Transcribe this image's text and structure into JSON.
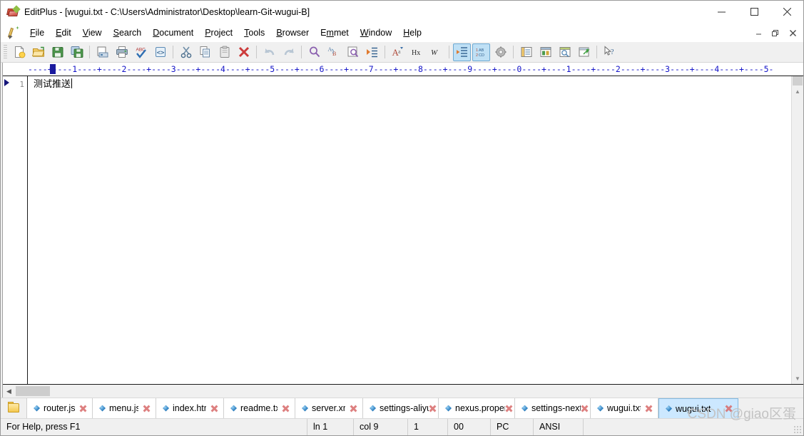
{
  "window": {
    "title": "EditPlus - [wugui.txt - C:\\Users\\Administrator\\Desktop\\learn-Git-wugui-B]",
    "app_icon": "editplus-icon",
    "minimize": "—",
    "maximize": "□",
    "close": "✕",
    "mdi_minimize": "–",
    "mdi_restore": "❐",
    "mdi_close": "✕"
  },
  "menu": [
    {
      "label": "File",
      "accel": "F"
    },
    {
      "label": "Edit",
      "accel": "E"
    },
    {
      "label": "View",
      "accel": "V"
    },
    {
      "label": "Search",
      "accel": "S"
    },
    {
      "label": "Document",
      "accel": "D"
    },
    {
      "label": "Project",
      "accel": "P"
    },
    {
      "label": "Tools",
      "accel": "T"
    },
    {
      "label": "Browser",
      "accel": "B"
    },
    {
      "label": "Emmet",
      "accel": "m"
    },
    {
      "label": "Window",
      "accel": "W"
    },
    {
      "label": "Help",
      "accel": "H"
    }
  ],
  "toolbar": [
    {
      "name": "new-file-icon",
      "sep_after": false,
      "active": false
    },
    {
      "name": "open-file-icon",
      "sep_after": false,
      "active": false
    },
    {
      "name": "save-icon",
      "sep_after": false,
      "active": false
    },
    {
      "name": "save-all-icon",
      "sep_after": true,
      "active": false
    },
    {
      "name": "print-preview-icon",
      "sep_after": false,
      "active": false
    },
    {
      "name": "print-icon",
      "sep_after": false,
      "active": false
    },
    {
      "name": "spell-check-icon",
      "sep_after": false,
      "active": false
    },
    {
      "name": "browser-preview-icon",
      "sep_after": true,
      "active": false
    },
    {
      "name": "cut-icon",
      "sep_after": false,
      "active": false
    },
    {
      "name": "copy-icon",
      "sep_after": false,
      "active": false
    },
    {
      "name": "paste-icon",
      "sep_after": false,
      "active": false
    },
    {
      "name": "delete-icon",
      "sep_after": true,
      "active": false
    },
    {
      "name": "undo-icon",
      "sep_after": false,
      "active": false
    },
    {
      "name": "redo-icon",
      "sep_after": true,
      "active": false
    },
    {
      "name": "find-icon",
      "sep_after": false,
      "active": false
    },
    {
      "name": "replace-icon",
      "sep_after": false,
      "active": false
    },
    {
      "name": "find-in-files-icon",
      "sep_after": false,
      "active": false
    },
    {
      "name": "goto-line-icon",
      "sep_after": true,
      "active": false
    },
    {
      "name": "change-case-icon",
      "sep_after": false,
      "active": false
    },
    {
      "name": "hex-view-icon",
      "sep_after": false,
      "active": false
    },
    {
      "name": "word-wrap-icon",
      "sep_after": true,
      "active": false
    },
    {
      "name": "indent-guide-icon",
      "sep_after": false,
      "active": true
    },
    {
      "name": "line-numbers-icon",
      "sep_after": false,
      "active": true
    },
    {
      "name": "preferences-icon",
      "sep_after": true,
      "active": false
    },
    {
      "name": "directory-window-icon",
      "sep_after": false,
      "active": false
    },
    {
      "name": "output-window-icon",
      "sep_after": false,
      "active": false
    },
    {
      "name": "clip-library-icon",
      "sep_after": false,
      "active": false
    },
    {
      "name": "document-selector-icon",
      "sep_after": true,
      "active": false
    },
    {
      "name": "context-help-icon",
      "sep_after": false,
      "active": false
    }
  ],
  "ruler": {
    "text": "----+----1----+----2----+----3----+----4----+----5----+----6----+----7----+----8----+----9----+----0----+----1----+----2----+----3----+----4----+----5-",
    "caret_marker": "column-caret-marker"
  },
  "editor": {
    "line_number": "1",
    "bookmark": "line-marker-triangle",
    "lines": [
      {
        "number": "1",
        "text": "测试推送"
      }
    ]
  },
  "tabs": [
    {
      "label": "router.js",
      "active": false
    },
    {
      "label": "menu.js",
      "active": false
    },
    {
      "label": "index.html",
      "active": false
    },
    {
      "label": "readme.txt",
      "active": false
    },
    {
      "label": "server.xml",
      "active": false
    },
    {
      "label": "settings-aliyu",
      "active": false
    },
    {
      "label": "nexus.proper",
      "active": false
    },
    {
      "label": "settings-next",
      "active": false
    },
    {
      "label": "wugui.txt",
      "active": false
    },
    {
      "label": "wugui.txt",
      "active": true
    }
  ],
  "statusbar": {
    "help": "For Help, press F1",
    "line": "ln 1",
    "column": "col 9",
    "sel": "1",
    "char": "00",
    "platform": "PC",
    "encoding": "ANSI"
  },
  "watermark": "CSDN @giao区蛋",
  "colors": {
    "accent": "#cce8ff",
    "ruler": "#1414c8",
    "tab_close": "#d86a6a",
    "toolbar_active": "#bfe0f5"
  }
}
